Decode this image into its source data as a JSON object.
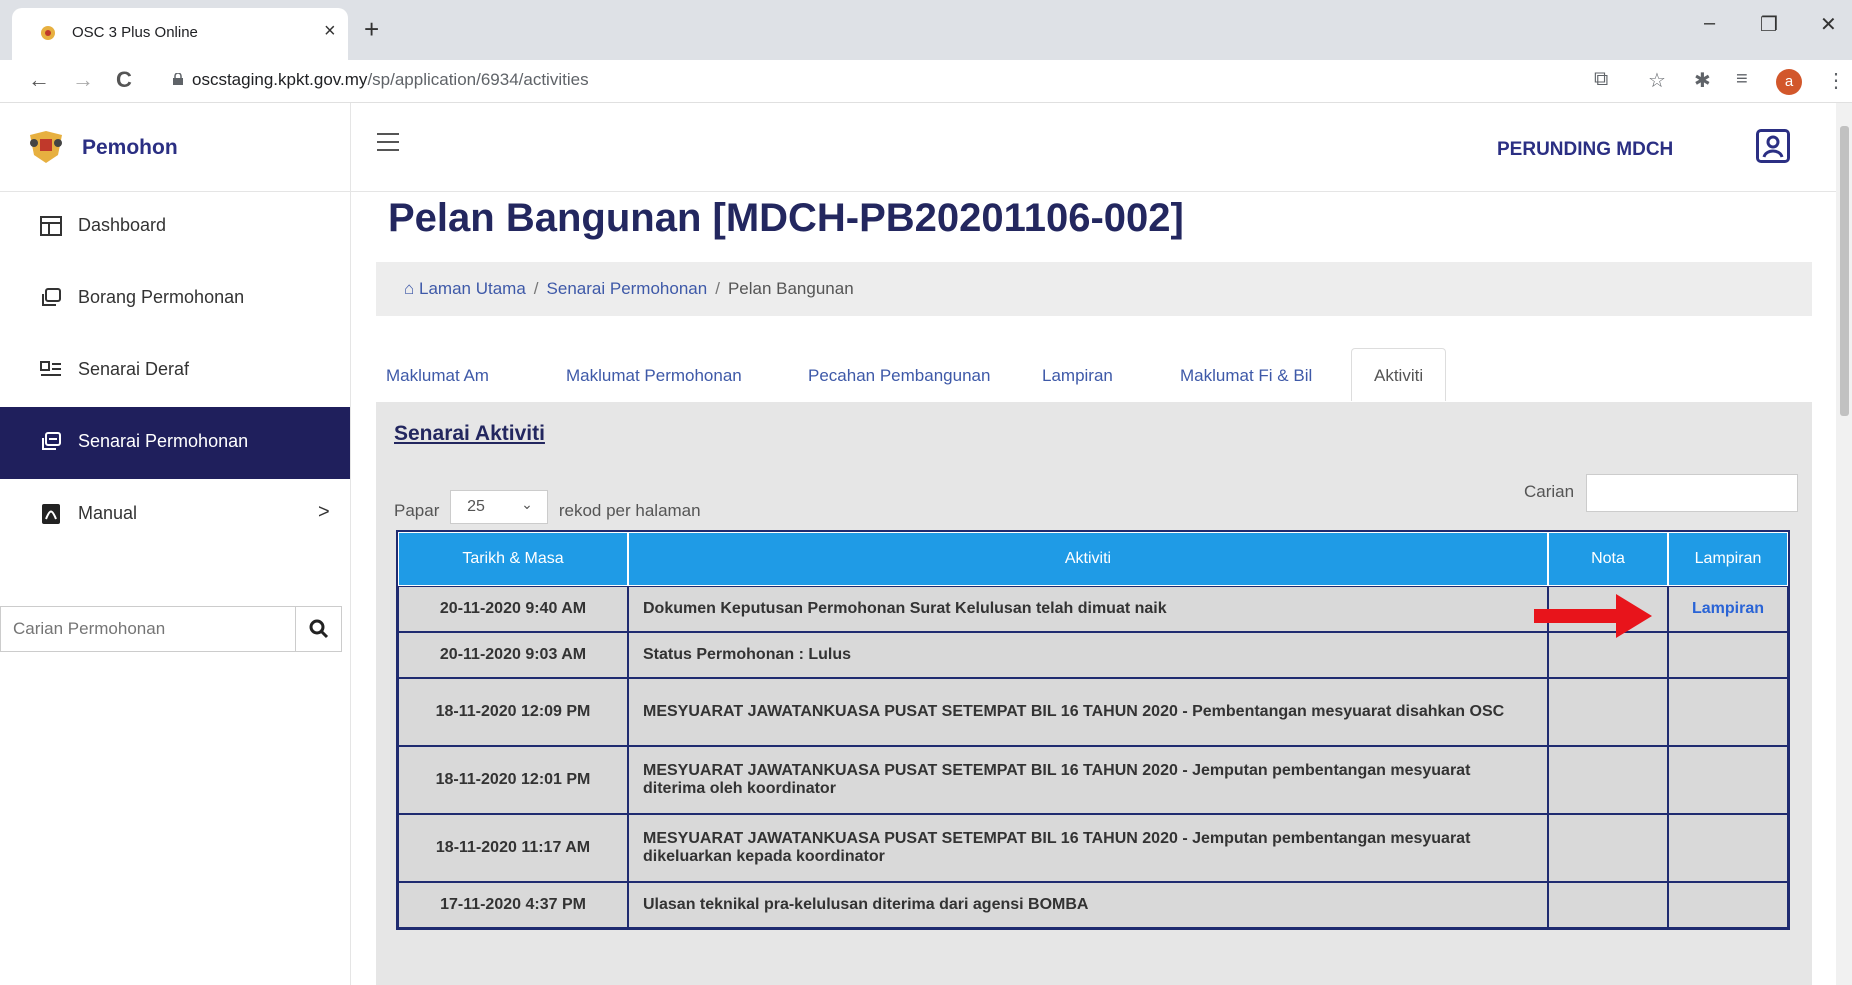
{
  "browser": {
    "tab_title": "OSC 3 Plus Online",
    "tab_close": "×",
    "new_tab": "+",
    "url_host": "oscstaging.kpkt.gov.my",
    "url_path": "/sp/application/6934/activities",
    "profile_initial": "a",
    "minimize": "–",
    "restore": "❐",
    "close": "✕",
    "back": "←",
    "forward": "→",
    "reload": "C"
  },
  "sidebar": {
    "brand": "Pemohon",
    "items": [
      {
        "label": "Dashboard"
      },
      {
        "label": "Borang Permohonan"
      },
      {
        "label": "Senarai Deraf"
      },
      {
        "label": "Senarai Permohonan"
      },
      {
        "label": "Manual"
      }
    ],
    "manual_chevron": ">",
    "search_placeholder": "Carian Permohonan"
  },
  "header": {
    "user": "PERUNDING MDCH"
  },
  "page": {
    "title": "Pelan Bangunan [MDCH-PB20201106-002]",
    "breadcrumb": [
      "Laman Utama",
      "Senarai Permohonan",
      "Pelan Bangunan"
    ],
    "breadcrumb_sep": "/",
    "tabs": [
      "Maklumat Am",
      "Maklumat Permohonan",
      "Pecahan Pembangunan",
      "Lampiran",
      "Maklumat Fi & Bil",
      "Aktiviti"
    ],
    "active_tab": "Aktiviti"
  },
  "panel": {
    "title": "Senarai Aktiviti",
    "show_prefix": "Papar",
    "page_size": "25",
    "show_suffix": "rekod per halaman",
    "search_label": "Carian",
    "columns": [
      "Tarikh & Masa",
      "Aktiviti",
      "Nota",
      "Lampiran"
    ],
    "rows": [
      {
        "date": "20-11-2020 9:40 AM",
        "activity": "Dokumen Keputusan Permohonan Surat Kelulusan telah dimuat naik",
        "nota": "",
        "lampiran": "Lampiran"
      },
      {
        "date": "20-11-2020 9:03 AM",
        "activity": "Status Permohonan : Lulus",
        "nota": "",
        "lampiran": ""
      },
      {
        "date": "18-11-2020 12:09 PM",
        "activity": "MESYUARAT JAWATANKUASA PUSAT SETEMPAT BIL 16 TAHUN 2020 - Pembentangan mesyuarat disahkan OSC",
        "nota": "",
        "lampiran": ""
      },
      {
        "date": "18-11-2020 12:01 PM",
        "activity": "MESYUARAT JAWATANKUASA PUSAT SETEMPAT BIL 16 TAHUN 2020 - Jemputan pembentangan mesyuarat diterima oleh koordinator",
        "nota": "",
        "lampiran": ""
      },
      {
        "date": "18-11-2020 11:17 AM",
        "activity": "MESYUARAT JAWATANKUASA PUSAT SETEMPAT BIL 16 TAHUN 2020 - Jemputan pembentangan mesyuarat dikeluarkan kepada koordinator",
        "nota": "",
        "lampiran": ""
      },
      {
        "date": "17-11-2020 4:37 PM",
        "activity": "Ulasan teknikal pra-kelulusan diterima dari agensi BOMBA",
        "nota": "",
        "lampiran": ""
      }
    ]
  },
  "colors": {
    "primary": "#23275f",
    "sidebar_active": "#1f1f5c",
    "table_header": "#1f9be6",
    "link": "#3e59a8",
    "arrow": "#e8141b"
  }
}
